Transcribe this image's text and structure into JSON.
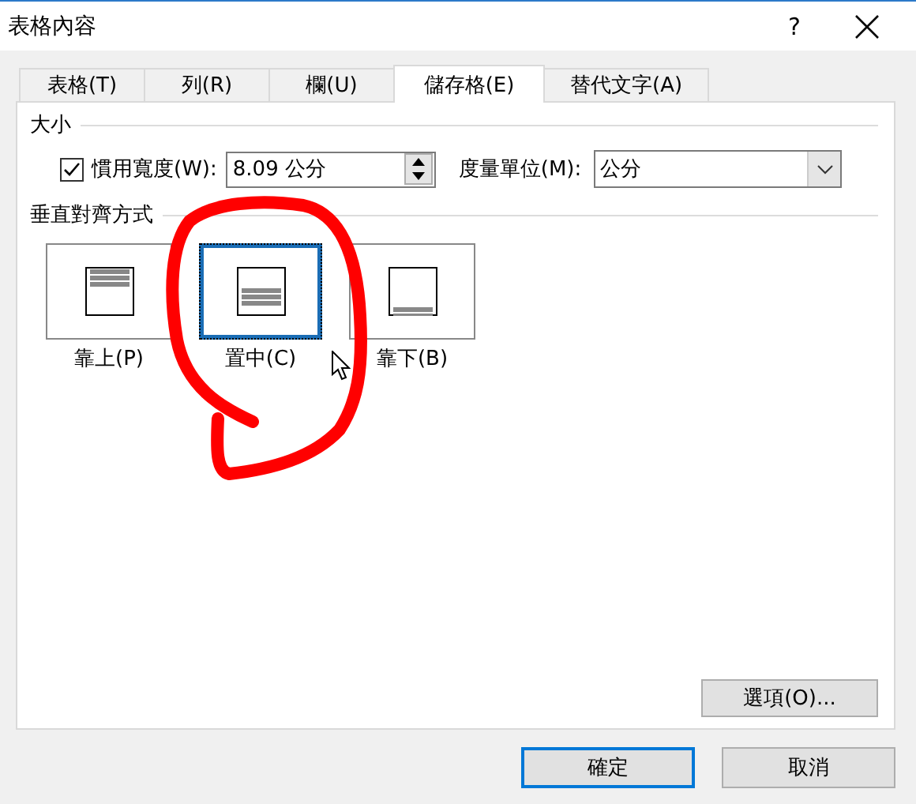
{
  "window": {
    "title": "表格內容",
    "help": "?"
  },
  "tabs": [
    {
      "label": "表格(T)",
      "selected": false
    },
    {
      "label": "列(R)",
      "selected": false
    },
    {
      "label": "欄(U)",
      "selected": false
    },
    {
      "label": "儲存格(E)",
      "selected": true
    },
    {
      "label": "替代文字(A)",
      "selected": false
    }
  ],
  "size": {
    "heading": "大小",
    "preferred_width": {
      "label": "慣用寬度(W):",
      "checked": true,
      "value": "8.09 公分"
    },
    "unit": {
      "label": "度量單位(M):",
      "value": "公分"
    }
  },
  "vertical_alignment": {
    "heading": "垂直對齊方式",
    "options": [
      {
        "label": "靠上(P)",
        "kind": "top",
        "selected": false
      },
      {
        "label": "置中(C)",
        "kind": "middle",
        "selected": true
      },
      {
        "label": "靠下(B)",
        "kind": "bottom",
        "selected": false
      }
    ]
  },
  "options_button": "選項(O)...",
  "buttons": [
    {
      "label": "確定",
      "default": true
    },
    {
      "label": "取消",
      "default": false
    }
  ]
}
